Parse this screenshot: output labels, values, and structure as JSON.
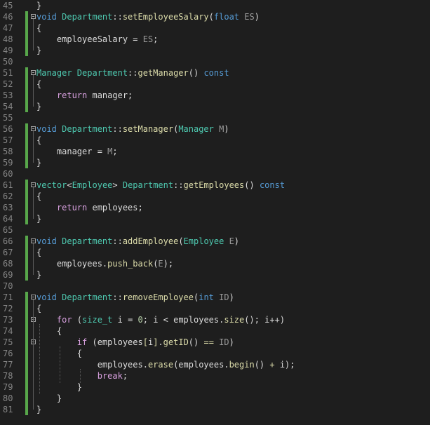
{
  "lines": [
    {
      "n": "45",
      "tokens": [
        {
          "t": "}",
          "c": "df"
        }
      ]
    },
    {
      "n": "46",
      "tokens": [
        {
          "t": "void ",
          "c": "kw"
        },
        {
          "t": "Department",
          "c": "ty"
        },
        {
          "t": "::",
          "c": "df"
        },
        {
          "t": "setEmployeeSalary",
          "c": "fn"
        },
        {
          "t": "(",
          "c": "df"
        },
        {
          "t": "float",
          "c": "kw"
        },
        {
          "t": " ES",
          "c": "pa"
        },
        {
          "t": ")",
          "c": "df"
        }
      ]
    },
    {
      "n": "47",
      "tokens": [
        {
          "t": "{",
          "c": "df"
        }
      ]
    },
    {
      "n": "48",
      "tokens": [
        {
          "t": "    employeeSalary = ",
          "c": "df"
        },
        {
          "t": "ES",
          "c": "pa"
        },
        {
          "t": ";",
          "c": "df"
        }
      ]
    },
    {
      "n": "49",
      "tokens": [
        {
          "t": "}",
          "c": "df"
        }
      ]
    },
    {
      "n": "50",
      "tokens": []
    },
    {
      "n": "51",
      "tokens": [
        {
          "t": "Manager ",
          "c": "ty"
        },
        {
          "t": "Department",
          "c": "ty"
        },
        {
          "t": "::",
          "c": "df"
        },
        {
          "t": "getManager",
          "c": "fn"
        },
        {
          "t": "() ",
          "c": "df"
        },
        {
          "t": "const",
          "c": "kw"
        }
      ]
    },
    {
      "n": "52",
      "tokens": [
        {
          "t": "{",
          "c": "df"
        }
      ]
    },
    {
      "n": "53",
      "tokens": [
        {
          "t": "    return",
          "c": "ct"
        },
        {
          "t": " manager;",
          "c": "df"
        }
      ]
    },
    {
      "n": "54",
      "tokens": [
        {
          "t": "}",
          "c": "df"
        }
      ]
    },
    {
      "n": "55",
      "tokens": []
    },
    {
      "n": "56",
      "tokens": [
        {
          "t": "void ",
          "c": "kw"
        },
        {
          "t": "Department",
          "c": "ty"
        },
        {
          "t": "::",
          "c": "df"
        },
        {
          "t": "setManager",
          "c": "fn"
        },
        {
          "t": "(",
          "c": "df"
        },
        {
          "t": "Manager",
          "c": "ty"
        },
        {
          "t": " M",
          "c": "pa"
        },
        {
          "t": ")",
          "c": "df"
        }
      ]
    },
    {
      "n": "57",
      "tokens": [
        {
          "t": "{",
          "c": "df"
        }
      ]
    },
    {
      "n": "58",
      "tokens": [
        {
          "t": "    manager = ",
          "c": "df"
        },
        {
          "t": "M",
          "c": "pa"
        },
        {
          "t": ";",
          "c": "df"
        }
      ]
    },
    {
      "n": "59",
      "tokens": [
        {
          "t": "}",
          "c": "df"
        }
      ]
    },
    {
      "n": "60",
      "tokens": []
    },
    {
      "n": "61",
      "tokens": [
        {
          "t": "vector",
          "c": "ty"
        },
        {
          "t": "<",
          "c": "df"
        },
        {
          "t": "Employee",
          "c": "ty"
        },
        {
          "t": "> ",
          "c": "df"
        },
        {
          "t": "Department",
          "c": "ty"
        },
        {
          "t": "::",
          "c": "df"
        },
        {
          "t": "getEmployees",
          "c": "fn"
        },
        {
          "t": "() ",
          "c": "df"
        },
        {
          "t": "const",
          "c": "kw"
        }
      ]
    },
    {
      "n": "62",
      "tokens": [
        {
          "t": "{",
          "c": "df"
        }
      ]
    },
    {
      "n": "63",
      "tokens": [
        {
          "t": "    return",
          "c": "ct"
        },
        {
          "t": " employees;",
          "c": "df"
        }
      ]
    },
    {
      "n": "64",
      "tokens": [
        {
          "t": "}",
          "c": "df"
        }
      ]
    },
    {
      "n": "65",
      "tokens": []
    },
    {
      "n": "66",
      "tokens": [
        {
          "t": "void ",
          "c": "kw"
        },
        {
          "t": "Department",
          "c": "ty"
        },
        {
          "t": "::",
          "c": "df"
        },
        {
          "t": "addEmployee",
          "c": "fn"
        },
        {
          "t": "(",
          "c": "df"
        },
        {
          "t": "Employee",
          "c": "ty"
        },
        {
          "t": " E",
          "c": "pa"
        },
        {
          "t": ")",
          "c": "df"
        }
      ]
    },
    {
      "n": "67",
      "tokens": [
        {
          "t": "{",
          "c": "df"
        }
      ]
    },
    {
      "n": "68",
      "tokens": [
        {
          "t": "    employees.",
          "c": "df"
        },
        {
          "t": "push_back",
          "c": "fn"
        },
        {
          "t": "(",
          "c": "df"
        },
        {
          "t": "E",
          "c": "pa"
        },
        {
          "t": ");",
          "c": "df"
        }
      ]
    },
    {
      "n": "69",
      "tokens": [
        {
          "t": "}",
          "c": "df"
        }
      ]
    },
    {
      "n": "70",
      "tokens": []
    },
    {
      "n": "71",
      "tokens": [
        {
          "t": "void ",
          "c": "kw"
        },
        {
          "t": "Department",
          "c": "ty"
        },
        {
          "t": "::",
          "c": "df"
        },
        {
          "t": "removeEmployee",
          "c": "fn"
        },
        {
          "t": "(",
          "c": "df"
        },
        {
          "t": "int",
          "c": "kw"
        },
        {
          "t": " ID",
          "c": "pa"
        },
        {
          "t": ")",
          "c": "df"
        }
      ]
    },
    {
      "n": "72",
      "tokens": [
        {
          "t": "{",
          "c": "df"
        }
      ]
    },
    {
      "n": "73",
      "tokens": [
        {
          "t": "    for",
          "c": "ct"
        },
        {
          "t": " (",
          "c": "df"
        },
        {
          "t": "size_t",
          "c": "ty"
        },
        {
          "t": " i = ",
          "c": "df"
        },
        {
          "t": "0",
          "c": "nu"
        },
        {
          "t": "; i < employees.",
          "c": "df"
        },
        {
          "t": "size",
          "c": "fn"
        },
        {
          "t": "(); i++)",
          "c": "df"
        }
      ]
    },
    {
      "n": "74",
      "tokens": [
        {
          "t": "    {",
          "c": "df"
        }
      ]
    },
    {
      "n": "75",
      "tokens": [
        {
          "t": "        if",
          "c": "ct"
        },
        {
          "t": " (employees",
          "c": "df"
        },
        {
          "t": "[",
          "c": "fn"
        },
        {
          "t": "i",
          "c": "df"
        },
        {
          "t": "]",
          "c": "fn"
        },
        {
          "t": ".",
          "c": "df"
        },
        {
          "t": "getID",
          "c": "fn"
        },
        {
          "t": "() ",
          "c": "df"
        },
        {
          "t": "==",
          "c": "fn"
        },
        {
          "t": " ",
          "c": "df"
        },
        {
          "t": "ID",
          "c": "pa"
        },
        {
          "t": ")",
          "c": "df"
        }
      ]
    },
    {
      "n": "76",
      "tokens": [
        {
          "t": "        {",
          "c": "df"
        }
      ]
    },
    {
      "n": "77",
      "tokens": [
        {
          "t": "            employees.",
          "c": "df"
        },
        {
          "t": "erase",
          "c": "fn"
        },
        {
          "t": "(employees.",
          "c": "df"
        },
        {
          "t": "begin",
          "c": "fn"
        },
        {
          "t": "() ",
          "c": "df"
        },
        {
          "t": "+",
          "c": "fn"
        },
        {
          "t": " i);",
          "c": "df"
        }
      ]
    },
    {
      "n": "78",
      "tokens": [
        {
          "t": "            break",
          "c": "ct"
        },
        {
          "t": ";",
          "c": "df"
        }
      ]
    },
    {
      "n": "79",
      "tokens": [
        {
          "t": "        }",
          "c": "df"
        }
      ]
    },
    {
      "n": "80",
      "tokens": [
        {
          "t": "    }",
          "c": "df"
        }
      ]
    },
    {
      "n": "81",
      "tokens": [
        {
          "t": "}",
          "c": "df"
        }
      ]
    }
  ]
}
